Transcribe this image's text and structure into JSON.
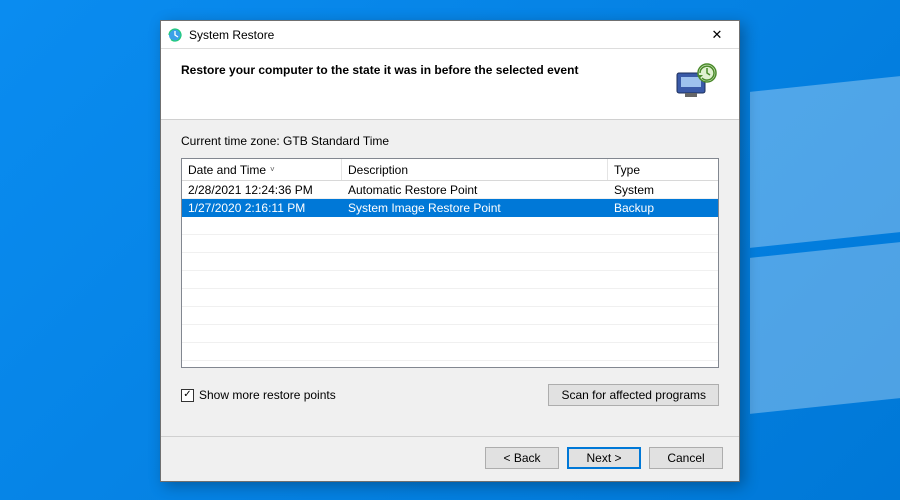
{
  "window": {
    "title": "System Restore",
    "close_label": "✕"
  },
  "header": {
    "heading": "Restore your computer to the state it was in before the selected event"
  },
  "time_zone": {
    "label_prefix": "Current time zone: ",
    "value": "GTB Standard Time"
  },
  "table": {
    "columns": {
      "date_time": "Date and Time",
      "description": "Description",
      "type": "Type"
    },
    "sort_indicator": "˅",
    "rows": [
      {
        "date_time": "2/28/2021 12:24:36 PM",
        "description": "Automatic Restore Point",
        "type": "System",
        "selected": false
      },
      {
        "date_time": "1/27/2020 2:16:11 PM",
        "description": "System Image Restore Point",
        "type": "Backup",
        "selected": true
      }
    ]
  },
  "show_more": {
    "checked": true,
    "label": "Show more restore points"
  },
  "scan_button": "Scan for affected programs",
  "footer": {
    "back": "< Back",
    "next": "Next >",
    "cancel": "Cancel"
  }
}
